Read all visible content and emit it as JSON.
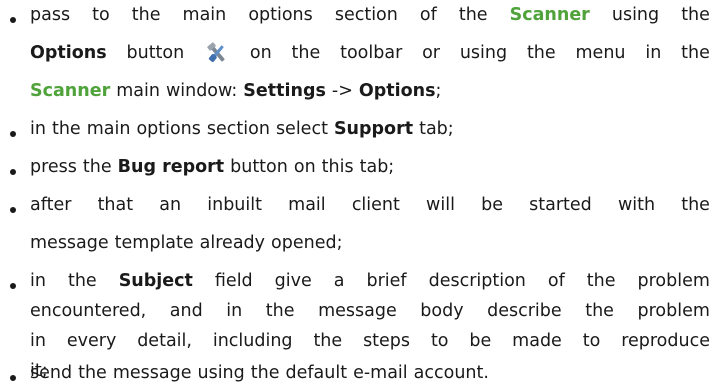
{
  "items": [
    {
      "lines": [
        [
          "pass",
          "to",
          "the",
          "main",
          "options",
          "section",
          "of",
          "the",
          {
            "t": "Scanner",
            "s": "g"
          },
          "using",
          "the"
        ],
        [
          {
            "t": "Options",
            "s": "b"
          },
          "button",
          {
            "icon": "tools-icon"
          },
          "on",
          "the",
          "toolbar",
          "or",
          "using",
          "the",
          "menu",
          "in",
          "the"
        ],
        [
          {
            "t": "Scanner",
            "s": "g"
          },
          "main",
          "window:",
          {
            "t": "Settings",
            "s": "b"
          },
          "->",
          {
            "t": "Options",
            "s": "b"
          },
          ";"
        ]
      ]
    },
    {
      "lines": [
        [
          "in",
          "the",
          "main",
          "options",
          "section",
          "select",
          {
            "t": "Support",
            "s": "b"
          },
          "tab;"
        ]
      ]
    },
    {
      "lines": [
        [
          "press",
          "the",
          {
            "t": "Bug report",
            "s": "b"
          },
          "button",
          "on",
          "this",
          "tab;"
        ]
      ]
    },
    {
      "lines": [
        [
          "after",
          "that",
          "an",
          "inbuilt",
          "mail",
          "client",
          "will",
          "be",
          "started",
          "with",
          "the"
        ],
        [
          "message",
          "template",
          "already",
          "opened;"
        ]
      ]
    },
    {
      "lines": [
        [
          "in",
          "the",
          {
            "t": "Subject",
            "s": "b"
          },
          "field",
          "give",
          "a",
          "brief",
          "description",
          "of",
          "the",
          "problem"
        ],
        [
          "encountered,",
          "and",
          "in",
          "the",
          "message",
          "body",
          "describe",
          "the",
          "problem"
        ],
        [
          "in",
          "every",
          "detail,",
          "including",
          "the",
          "steps",
          "to",
          "be",
          "made",
          "to",
          "reproduce"
        ],
        [
          "it;"
        ]
      ]
    },
    {
      "lines": [
        [
          "send",
          "the",
          "message",
          "using",
          "the",
          "default",
          "e-mail",
          "account."
        ]
      ]
    }
  ],
  "colors": {
    "text": "#1a1a1a",
    "accent_green": "#4fa33a"
  }
}
